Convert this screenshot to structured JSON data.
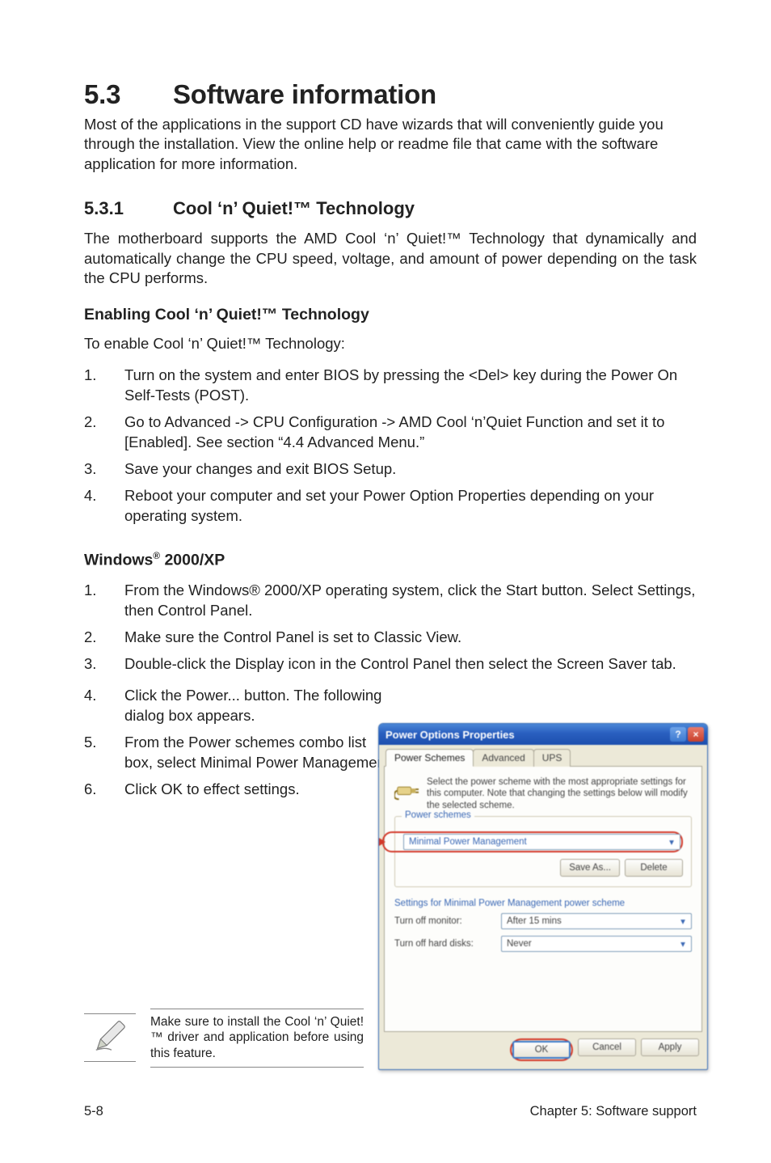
{
  "heading": {
    "num": "5.3",
    "text": "Software information"
  },
  "intro": "Most of the applications in the support CD have wizards that will conveniently guide you through the installation. View the online help or readme file that came with the software application for more information.",
  "sub1": {
    "num": "5.3.1",
    "text": "Cool ‘n’ Quiet!™ Technology"
  },
  "sub1_body": "The motherboard supports the AMD Cool ‘n’ Quiet!™ Technology that dynamically and automatically change the CPU speed, voltage, and amount of power depending on the task the CPU performs.",
  "sub2": "Enabling Cool ‘n’ Quiet!™ Technology",
  "sub2_lead": "To enable Cool ‘n’ Quiet!™ Technology:",
  "enable_steps": [
    "Turn on the system and enter BIOS by pressing the <Del> key during the Power On Self-Tests (POST).",
    "Go to Advanced -> CPU Configuration -> AMD Cool ‘n’Quiet Function and set it to [Enabled]. See section “4.4 Advanced Menu.”",
    "Save your changes and exit  BIOS Setup.",
    "Reboot your computer and set your Power Option Properties depending on your operating system."
  ],
  "win_heading_pre": "Windows",
  "win_heading_post": " 2000/XP",
  "win_steps": [
    "From the Windows® 2000/XP operating system, click the Start button. Select Settings, then Control Panel.",
    "Make sure the Control Panel is set to Classic View.",
    "Double-click the Display icon in the Control Panel then select the Screen Saver tab.",
    "Click the Power... button. The following dialog box appears.",
    "From the Power schemes combo list box, select Minimal Power Management.",
    "Click OK to effect settings."
  ],
  "note": "Make sure to install the Cool ‘n’ Quiet!™ driver and application before using this feature.",
  "footer": {
    "left": "5-8",
    "right": "Chapter 5: Software support"
  },
  "dialog": {
    "title": "Power Options Properties",
    "tabs": [
      "Power Schemes",
      "Advanced",
      "UPS"
    ],
    "desc": "Select the power scheme with the most appropriate settings for this computer. Note that changing the settings below will modify the selected scheme.",
    "schemes_legend": "Power schemes",
    "scheme_selected": "Minimal Power Management",
    "save_as": "Save As...",
    "delete": "Delete",
    "settings_title": "Settings for Minimal Power Management power scheme",
    "monitor_label": "Turn off monitor:",
    "monitor_value": "After 15 mins",
    "disks_label": "Turn off hard disks:",
    "disks_value": "Never",
    "ok": "OK",
    "cancel": "Cancel",
    "apply": "Apply"
  }
}
